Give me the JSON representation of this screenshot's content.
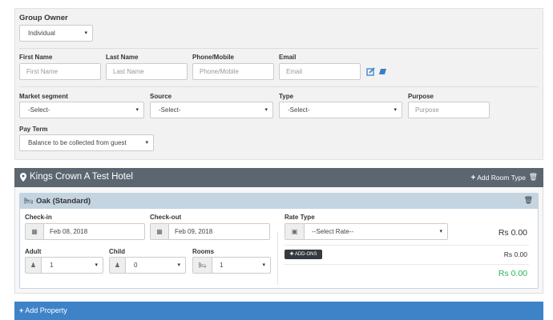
{
  "group": {
    "owner_label": "Group Owner",
    "owner_value": "Individual",
    "first_name": {
      "label": "First Name",
      "placeholder": "First Name"
    },
    "last_name": {
      "label": "Last Name",
      "placeholder": "Last Name"
    },
    "phone": {
      "label": "Phone/Mobile",
      "placeholder": "Phone/Mobile"
    },
    "email": {
      "label": "Email",
      "placeholder": "Email"
    },
    "market": {
      "label": "Market segment",
      "value": "-Select-"
    },
    "source": {
      "label": "Source",
      "value": "-Select-"
    },
    "type": {
      "label": "Type",
      "value": "-Select-"
    },
    "purpose": {
      "label": "Purpose",
      "placeholder": "Purpose"
    },
    "pay_term": {
      "label": "Pay Term",
      "value": "Balance to be collected from guest"
    }
  },
  "property": {
    "name": "Kings Crown A Test Hotel",
    "add_room_type": "Add Room Type",
    "room": {
      "title": "Oak (Standard)",
      "checkin": {
        "label": "Check-in",
        "value": "Feb 08, 2018"
      },
      "checkout": {
        "label": "Check-out",
        "value": "Feb 09, 2018"
      },
      "adult": {
        "label": "Adult",
        "value": "1"
      },
      "child": {
        "label": "Child",
        "value": "0"
      },
      "rooms": {
        "label": "Rooms",
        "value": "1"
      },
      "rate_type": {
        "label": "Rate Type",
        "value": "--Select Rate--"
      },
      "rate_amount": "Rs 0.00",
      "addons_label": "ADD-ONS",
      "addons_amount": "Rs 0.00",
      "total": "Rs 0.00"
    }
  },
  "add_property": "Add Property",
  "colors": {
    "hotel_header": "#5b6670",
    "room_header": "#c4d4e1",
    "add_property": "#3e83c8",
    "total": "#2bb35a",
    "icon_blue": "#3a7fc4"
  }
}
